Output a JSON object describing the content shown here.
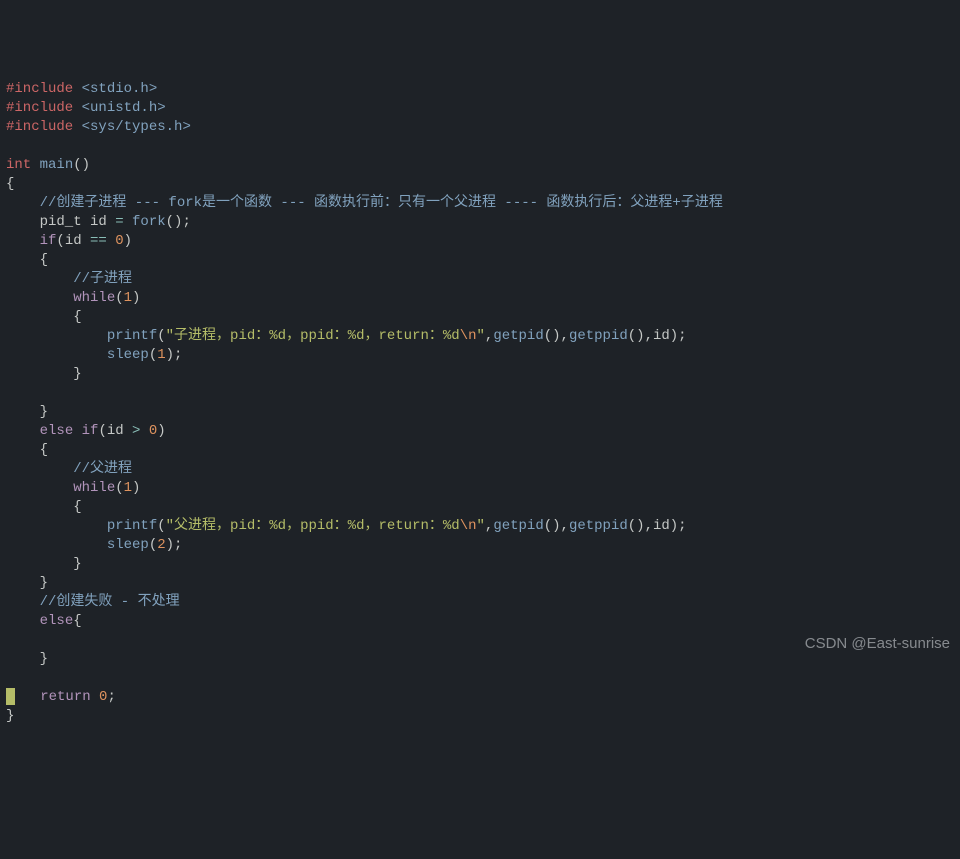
{
  "lines": {
    "l1a": "#include ",
    "l1b": "<stdio.h>",
    "l2a": "#include ",
    "l2b": "<unistd.h>",
    "l3a": "#include ",
    "l3b": "<sys/types.h>",
    "l5a": "int ",
    "l5b": "main",
    "l5c": "()",
    "l6": "{",
    "l7": "    //创建子进程 --- fork是一个函数 --- 函数执行前：只有一个父进程 ---- 函数执行后：父进程+子进程",
    "l8a": "    pid_t id ",
    "l8b": "= ",
    "l8c": "fork",
    "l8d": "();",
    "l9a": "    ",
    "l9b": "if",
    "l9c": "(id ",
    "l9d": "==",
    "l9e": " ",
    "l9f": "0",
    "l9g": ")",
    "l10": "    {",
    "l11": "        //子进程",
    "l12a": "        ",
    "l12b": "while",
    "l12c": "(",
    "l12d": "1",
    "l12e": ")",
    "l13": "        {",
    "l14a": "            ",
    "l14b": "printf",
    "l14c": "(",
    "l14d": "\"子进程，pid：%d，ppid：%d，return：%d",
    "l14e": "\\n",
    "l14f": "\"",
    "l14g": ",",
    "l14h": "getpid",
    "l14i": "(),",
    "l14j": "getppid",
    "l14k": "(),id);",
    "l15a": "            ",
    "l15b": "sleep",
    "l15c": "(",
    "l15d": "1",
    "l15e": ");",
    "l16": "        }",
    "l18": "    }",
    "l19a": "    ",
    "l19b": "else",
    "l19c": " ",
    "l19d": "if",
    "l19e": "(id ",
    "l19f": ">",
    "l19g": " ",
    "l19h": "0",
    "l19i": ")",
    "l20": "    {",
    "l21": "        //父进程",
    "l22a": "        ",
    "l22b": "while",
    "l22c": "(",
    "l22d": "1",
    "l22e": ")",
    "l23": "        {",
    "l24a": "            ",
    "l24b": "printf",
    "l24c": "(",
    "l24d": "\"父进程，pid：%d，ppid：%d，return：%d",
    "l24e": "\\n",
    "l24f": "\"",
    "l24g": ",",
    "l24h": "getpid",
    "l24i": "(),",
    "l24j": "getppid",
    "l24k": "(),id);",
    "l25a": "            ",
    "l25b": "sleep",
    "l25c": "(",
    "l25d": "2",
    "l25e": ");",
    "l26": "        }",
    "l27": "    }",
    "l28": "    //创建失败 - 不处理",
    "l29a": "    ",
    "l29b": "else",
    "l29c": "{",
    "l31": "    }",
    "l33a": "    ",
    "l33b": "return",
    "l33c": " ",
    "l33d": "0",
    "l33e": ";",
    "l34": "}"
  },
  "watermark": "CSDN @East-sunrise"
}
